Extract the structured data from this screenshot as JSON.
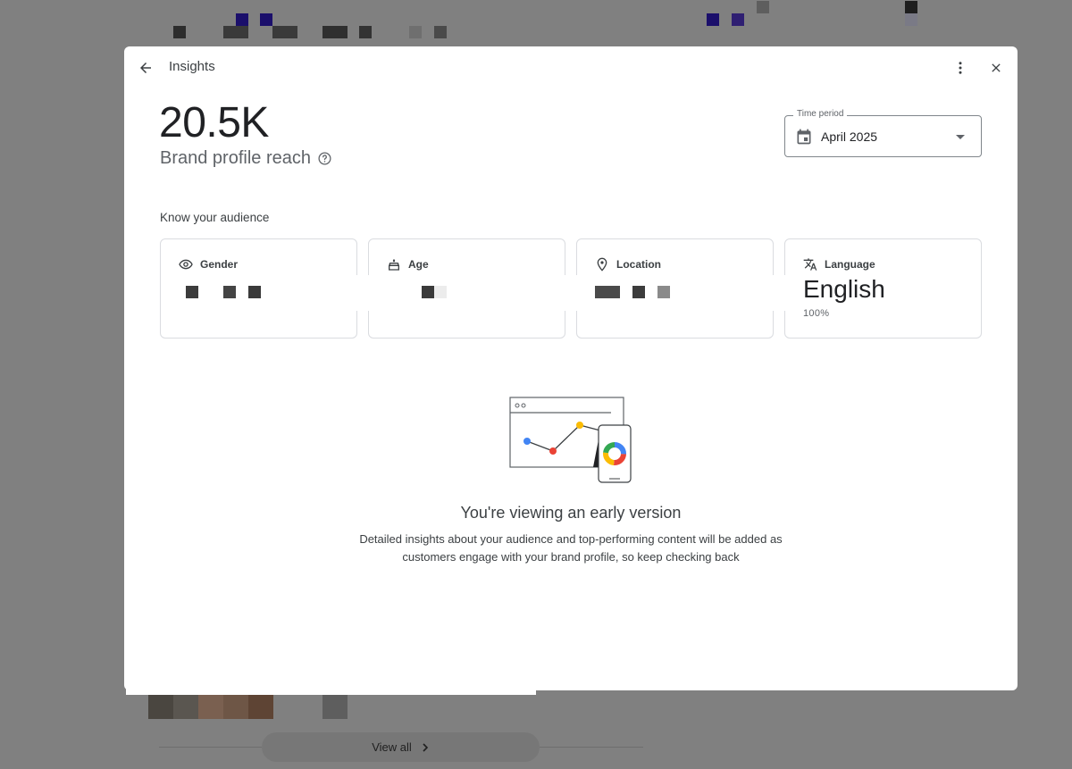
{
  "dialog": {
    "title": "Insights",
    "back_icon": "arrow-back-icon",
    "more_icon": "more-vert-icon",
    "close_icon": "close-icon"
  },
  "metric": {
    "value": "20.5K",
    "label": "Brand profile reach",
    "help_icon": "help-outline-icon"
  },
  "time_period": {
    "legend": "Time period",
    "value": "April 2025",
    "icon": "calendar-icon"
  },
  "audience": {
    "title": "Know your audience",
    "cards": [
      {
        "label": "Gender",
        "icon": "eye-icon"
      },
      {
        "label": "Age",
        "icon": "cake-icon"
      },
      {
        "label": "Location",
        "icon": "location-pin-icon"
      },
      {
        "label": "Language",
        "icon": "translate-icon",
        "value": "English",
        "share": "100%"
      }
    ]
  },
  "empty_state": {
    "title": "You're viewing an early version",
    "description": "Detailed insights about your audience and top-performing content will be added as customers engage with your brand profile, so keep checking back"
  },
  "background": {
    "view_all_label": "View all"
  },
  "colors": {
    "scrim": "#808080",
    "surface": "#ffffff",
    "text_primary": "#202124",
    "text_secondary": "#5f6368",
    "card_border": "#dadce0",
    "google_blue": "#4285f4",
    "google_red": "#ea4335",
    "google_yellow": "#fbbc04",
    "google_green": "#34a853"
  }
}
